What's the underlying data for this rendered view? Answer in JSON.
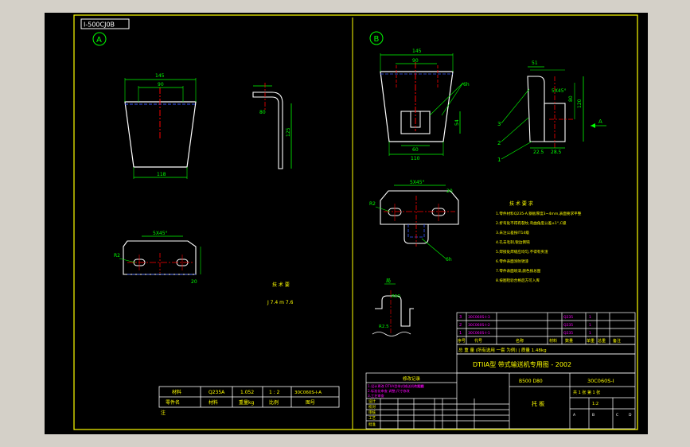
{
  "colors": {
    "background": "#000000",
    "frame": "#ffff00",
    "outline": "#ffffff",
    "dimension": "#00ff00",
    "center_line": "#ff0000",
    "hidden_line": "#0000ff",
    "annotation": "#ff00ff"
  },
  "drawing_code_tag": "I-500CJ0B",
  "view_a": {
    "label": "A",
    "dims": {
      "top_width": "145",
      "inner_width": "90",
      "bottom_width": "118",
      "height": "125",
      "bend": "80",
      "hole_spacing": "5X45°",
      "hole_dia": "R2",
      "side": "20"
    },
    "note_title": "技 术 要",
    "note_line": "J 7.4 m 7.6"
  },
  "view_b": {
    "label": "B",
    "dims": {
      "top_width": "145",
      "inner_width": "90",
      "slot_width": "60",
      "bottom_width": "110",
      "height": "54",
      "callout": "6h",
      "side_width": "51",
      "side_height": "120",
      "side_inner": "80",
      "chamfer": "5X45°",
      "base_left": "22.5",
      "base_right": "28.5",
      "section_mark": "A",
      "balloons": [
        "1",
        "2",
        "3"
      ],
      "plan_chamfer": "5X45°",
      "plan_side": "20",
      "plan_dia": "R2",
      "plan_callout": "6h"
    },
    "detail_label": "局",
    "detail_dims": [
      "R50",
      "R2.5"
    ],
    "tech_title": "技 术 要 求",
    "tech_notes": [
      "1.零件材料Q235-A,钢板厚度3~4mm,表面要求平整",
      "2.折弯处不得有裂纹,弯曲角度公差±1°,C级",
      "3.未注公差按IT14级",
      "4.孔去毛刺,锐边倒钝",
      "5.焊接处焊缝应均匀,不得有夹渣",
      "6.零件表面涂防锈漆",
      "7.零件表面喷漆,颜色按总图",
      "8.按图检验合格后方可入库"
    ]
  },
  "small_table": {
    "headers": [
      "材料",
      "Q235A",
      "1.052",
      "1 : 2",
      "30C060S-I-A"
    ],
    "row2": [
      "零件名",
      "材料",
      "重量kg",
      "比例",
      "图号"
    ],
    "footer": "注"
  },
  "bom": {
    "rows": [
      [
        "3",
        "30C060S-I-3",
        "",
        "Q235",
        "1",
        "",
        "",
        ""
      ],
      [
        "2",
        "30C060S-I-2",
        "",
        "Q235",
        "1",
        "",
        "",
        ""
      ],
      [
        "1",
        "30C060S-I-1",
        "",
        "Q235",
        "1",
        "",
        "",
        ""
      ],
      [
        "序号",
        "代号",
        "名称",
        "材料",
        "数量",
        "单重",
        "总重",
        "备注"
      ]
    ]
  },
  "title_block": {
    "spec_line": "总 重 量  (所有选用 一套 为例)  | 质量 1.48kg",
    "project_title": "DTIIA型  带式输送机专用图 - 2002",
    "spec_code": "B500 D80",
    "drawing_no": "30C060S-I",
    "part_name": "托 板",
    "sheet_info": "共 1 张 第 1 张",
    "scale_label": "1:2",
    "change_title": "修改记录",
    "change_rows": [
      "1.设计更改 DTIIA型带式输送机专用图",
      "2.标准化审查 调整,尺寸修改",
      "3.工艺审查",
      "4.批准"
    ],
    "sign_rows": [
      [
        "设计",
        "",
        "",
        "",
        "",
        ""
      ],
      [
        "校对",
        "",
        "",
        "",
        "",
        ""
      ],
      [
        "审核",
        "",
        "",
        "",
        "",
        ""
      ],
      [
        "工艺",
        "",
        "",
        "",
        "",
        ""
      ],
      [
        "批准",
        "",
        "",
        "",
        "",
        ""
      ]
    ],
    "mini_labels": [
      "A",
      "B",
      "C",
      "D"
    ]
  }
}
